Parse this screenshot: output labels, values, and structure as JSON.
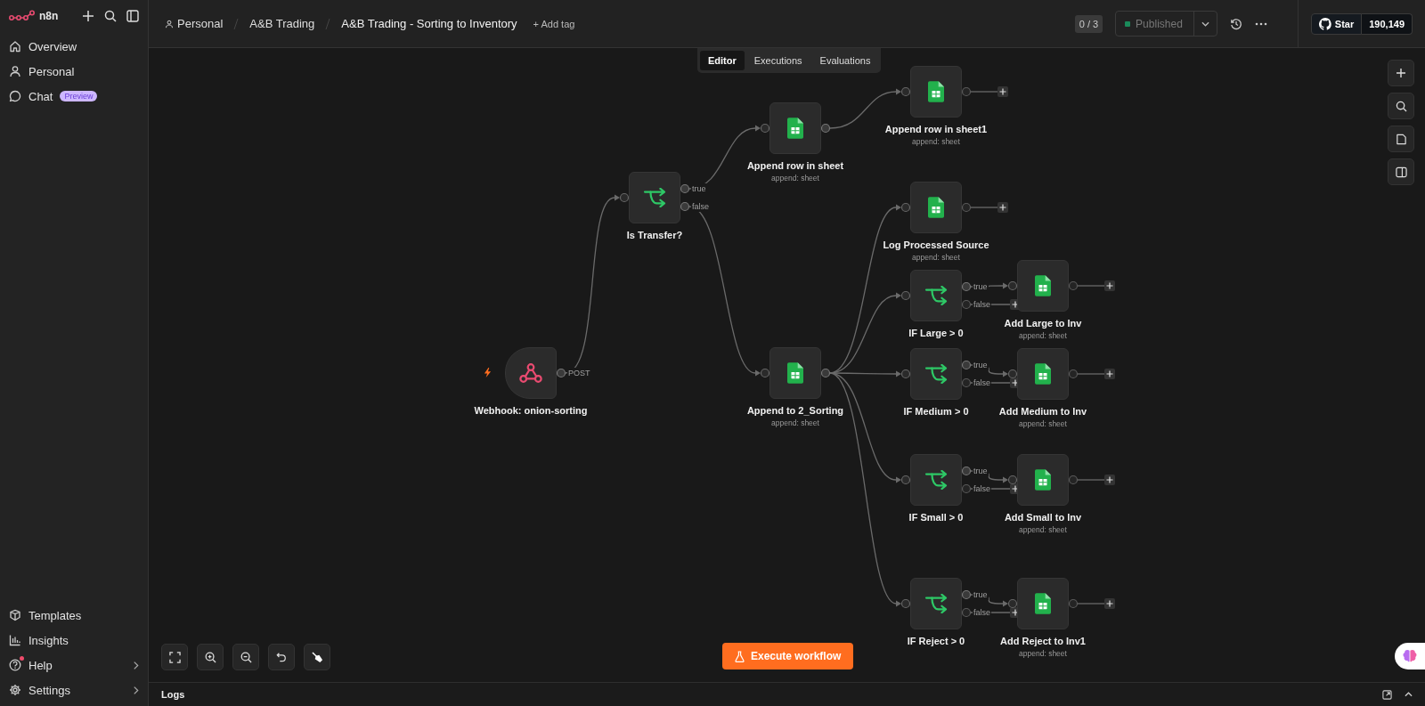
{
  "sidebar": {
    "logo": "n8n",
    "top_items": [
      {
        "label": "Overview"
      },
      {
        "label": "Personal"
      },
      {
        "label": "Chat",
        "badge": "Preview"
      }
    ],
    "bottom_items": [
      {
        "label": "Templates",
        "expandable": false,
        "notification": false
      },
      {
        "label": "Insights",
        "expandable": false,
        "notification": false
      },
      {
        "label": "Help",
        "expandable": true,
        "notification": true
      },
      {
        "label": "Settings",
        "expandable": true,
        "notification": false
      }
    ]
  },
  "header": {
    "breadcrumbs": [
      "Personal",
      "A&B Trading",
      "A&B Trading - Sorting to Inventory"
    ],
    "add_tag": "+ Add tag",
    "counter": "0 / 3",
    "publish": {
      "label": "Published",
      "disabled": true
    },
    "github": {
      "label": "Star",
      "count": "190,149"
    }
  },
  "tabs": [
    {
      "label": "Editor",
      "selected": true
    },
    {
      "label": "Executions",
      "selected": false
    },
    {
      "label": "Evaluations",
      "selected": false
    }
  ],
  "nodes": [
    {
      "name": "Webhook: onion-sorting",
      "kind": "webhook",
      "outputs": [
        {
          "label": "POST",
          "connected": true
        }
      ]
    },
    {
      "name": "Is Transfer?",
      "kind": "if",
      "outputs": [
        {
          "label": "true",
          "connected": true
        },
        {
          "label": "false",
          "connected": true
        }
      ]
    },
    {
      "name": "Append row in sheet",
      "subtitle": "append: sheet",
      "kind": "sheet",
      "outputs": [
        {
          "connected": true
        }
      ]
    },
    {
      "name": "Append row in sheet1",
      "subtitle": "append: sheet",
      "kind": "sheet",
      "outputs": [
        {
          "connected": false
        }
      ]
    },
    {
      "name": "Append to 2_Sorting",
      "subtitle": "append: sheet",
      "kind": "sheet",
      "outputs": [
        {
          "connected": true
        }
      ]
    },
    {
      "name": "Log Processed Source",
      "subtitle": "append: sheet",
      "kind": "sheet",
      "outputs": [
        {
          "connected": false
        }
      ]
    },
    {
      "name": "IF Large > 0",
      "kind": "if",
      "outputs": [
        {
          "label": "true",
          "connected": true
        },
        {
          "label": "false",
          "connected": false
        }
      ]
    },
    {
      "name": "Add Large to Inv",
      "subtitle": "append: sheet",
      "kind": "sheet",
      "outputs": [
        {
          "connected": false
        }
      ]
    },
    {
      "name": "IF Medium > 0",
      "kind": "if",
      "outputs": [
        {
          "label": "true",
          "connected": true
        },
        {
          "label": "false",
          "connected": false
        }
      ]
    },
    {
      "name": "Add Medium to Inv",
      "subtitle": "append: sheet",
      "kind": "sheet",
      "outputs": [
        {
          "connected": false
        }
      ]
    },
    {
      "name": "IF Small > 0",
      "kind": "if",
      "outputs": [
        {
          "label": "true",
          "connected": true
        },
        {
          "label": "false",
          "connected": false
        }
      ]
    },
    {
      "name": "Add Small to Inv",
      "subtitle": "append: sheet",
      "kind": "sheet",
      "outputs": [
        {
          "connected": false
        }
      ]
    },
    {
      "name": "IF Reject > 0",
      "kind": "if",
      "outputs": [
        {
          "label": "true",
          "connected": true
        },
        {
          "label": "false",
          "connected": false
        }
      ]
    },
    {
      "name": "Add Reject to Inv1",
      "subtitle": "append: sheet",
      "kind": "sheet",
      "outputs": [
        {
          "connected": false
        }
      ]
    }
  ],
  "execute_button": "Execute workflow",
  "logs": {
    "title": "Logs"
  }
}
